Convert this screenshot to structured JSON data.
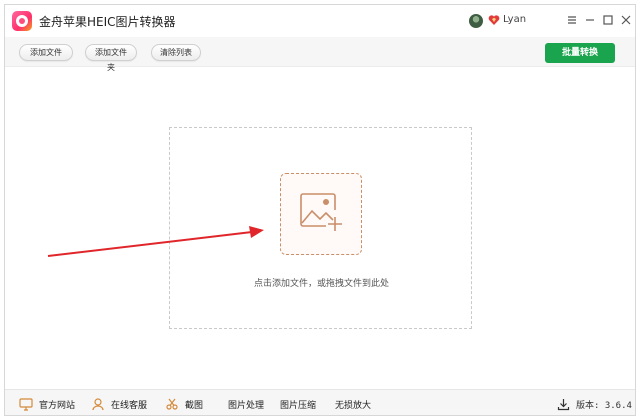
{
  "app": {
    "title": "金舟苹果HEIC图片转换器",
    "user": "Lyan"
  },
  "toolbar": {
    "add_file": "添加文件",
    "add_folder": "添加文件夹",
    "clear_list": "清除列表",
    "batch_convert": "批量转换"
  },
  "dropzone": {
    "hint": "点击添加文件，或拖拽文件到此处"
  },
  "bottombar": {
    "official_site": "官方网站",
    "online_support": "在线客服",
    "screenshot": "截图",
    "image_processing": "图片处理",
    "image_compress": "图片压缩",
    "lossless_enlarge": "无损放大",
    "version": "版本: 3.6.4"
  },
  "colors": {
    "accent_green": "#1aa44d",
    "upload_border": "#c98e6a",
    "arrow_red": "#e0262a"
  },
  "icons": {
    "vip": "heart-gem-icon",
    "upload": "image-add-icon",
    "official_site": "monitor-icon",
    "online_support": "user-headset-icon",
    "screenshot": "scissors-icon",
    "version": "download-icon"
  }
}
